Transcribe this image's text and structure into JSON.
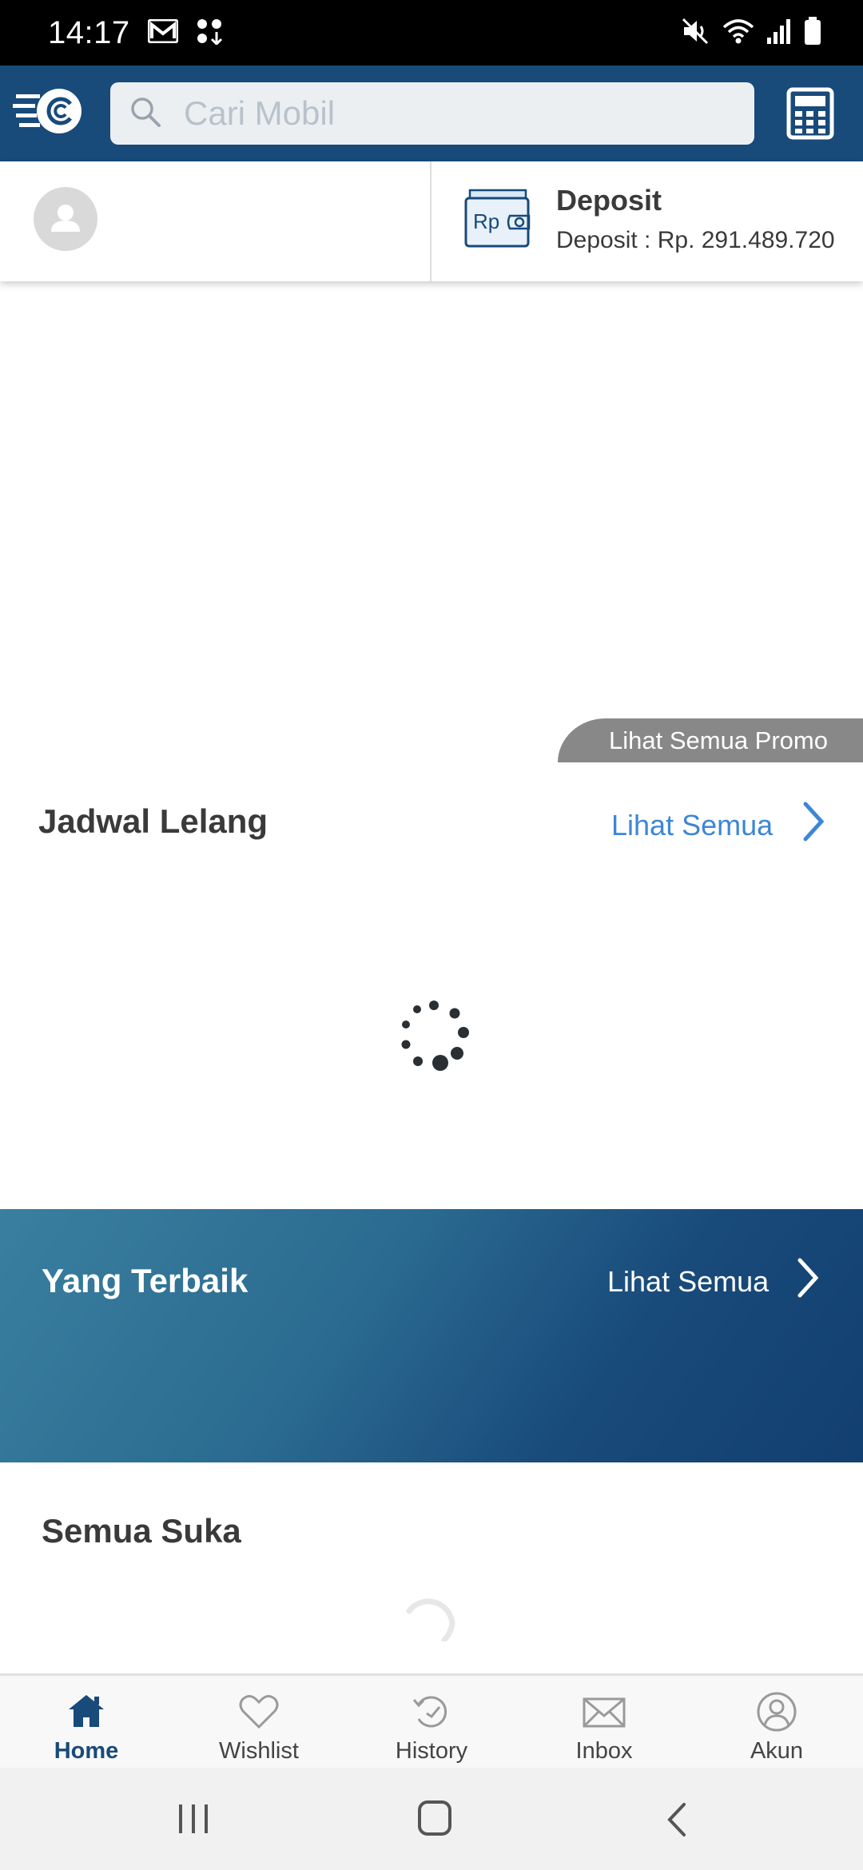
{
  "status_bar": {
    "time": "14:17"
  },
  "search": {
    "placeholder": "Cari Mobil"
  },
  "deposit": {
    "title": "Deposit",
    "amount": "Deposit : Rp. 291.489.720",
    "wallet_text": "Rp"
  },
  "promo": {
    "label": "Lihat Semua Promo"
  },
  "jadwal_lelang": {
    "title": "Jadwal Lelang",
    "see_all": "Lihat Semua"
  },
  "yang_terbaik": {
    "title": "Yang Terbaik",
    "see_all": "Lihat Semua"
  },
  "semua_suka": {
    "title": "Semua Suka"
  },
  "bottom_nav": {
    "items": [
      {
        "label": "Home",
        "icon": "home-icon",
        "active": true
      },
      {
        "label": "Wishlist",
        "icon": "heart-icon",
        "active": false
      },
      {
        "label": "History",
        "icon": "history-icon",
        "active": false
      },
      {
        "label": "Inbox",
        "icon": "mail-icon",
        "active": false
      },
      {
        "label": "Akun",
        "icon": "account-icon",
        "active": false
      }
    ]
  },
  "colors": {
    "brand": "#184a7a",
    "link": "#3d86d6",
    "promo_tab": "#888888"
  }
}
